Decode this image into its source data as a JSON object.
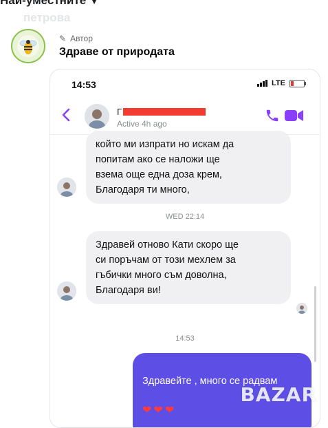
{
  "feed": {
    "sort_label": "Най-уместните",
    "faded_text": "петрова"
  },
  "post": {
    "author_badge": "Автор",
    "group_name": "Здраве от природата"
  },
  "phone": {
    "status_time": "14:53",
    "network": "LTE",
    "contact_name_visible": "Г",
    "contact_status": "Active 4h ago",
    "messages": {
      "m1": "който ми изпрати но искам  да\nпопитам ако се наложи ще\nвзема още една доза крем,\nБлагодаря ти много,",
      "stamp1": "WED 22:14",
      "m2": "Здравей отново Кати скоро ще\nси поръчам от този мехлем за\nгъбички много съм доволна,\nБлагодаря ви!",
      "stamp2": "14:53",
      "m3": "Здравейте , много се радвам",
      "m3_hearts": [
        "❤",
        "❤",
        "❤"
      ]
    }
  },
  "watermark": "BAZAR",
  "colors": {
    "messenger_purple": "#5d4ee6",
    "header_icon": "#8a3ffc",
    "redaction": "#f13c2f"
  }
}
